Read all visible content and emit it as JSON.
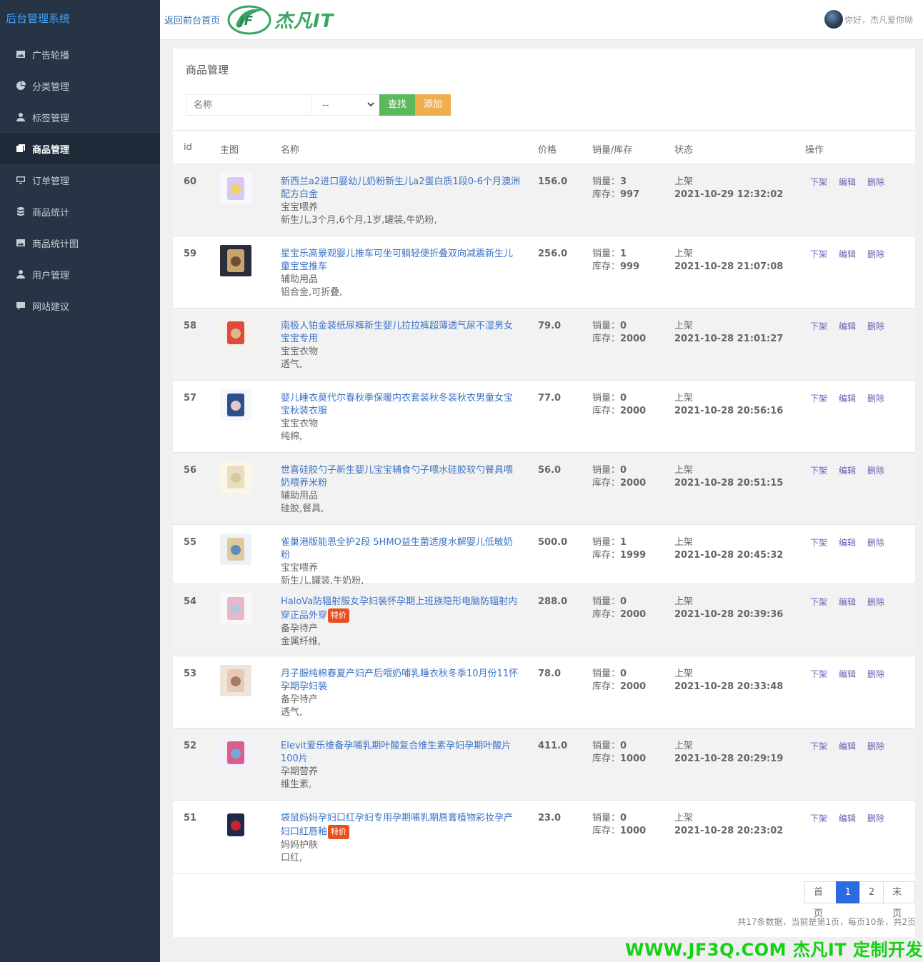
{
  "sidebar": {
    "brand": "后台管理系统",
    "items": [
      {
        "label": "广告轮播",
        "icon": "image-icon"
      },
      {
        "label": "分类管理",
        "icon": "pie-icon"
      },
      {
        "label": "标签管理",
        "icon": "user-tag-icon"
      },
      {
        "label": "商品管理",
        "icon": "window-icon",
        "active": true
      },
      {
        "label": "订单管理",
        "icon": "monitor-icon"
      },
      {
        "label": "商品统计",
        "icon": "database-icon"
      },
      {
        "label": "商品统计图",
        "icon": "image-icon"
      },
      {
        "label": "用户管理",
        "icon": "user-icon"
      },
      {
        "label": "网站建议",
        "icon": "comment-icon"
      }
    ]
  },
  "header": {
    "back_link": "返回前台首页",
    "logo_text": "杰凡IT",
    "greeting": "你好，杰凡爱你呦"
  },
  "page": {
    "title": "商品管理",
    "search": {
      "name_placeholder": "名称",
      "status_value": "--",
      "find_label": "查找",
      "add_label": "添加"
    }
  },
  "table": {
    "columns": [
      "id",
      "主图",
      "名称",
      "价格",
      "销量/库存",
      "状态",
      "操作"
    ],
    "sales_label": "销量：",
    "stock_label": "库存：",
    "actions": [
      "下架",
      "编辑",
      "删除"
    ],
    "rows": [
      {
        "id": "60",
        "name": "新西兰a2进口婴幼儿奶粉新生儿a2蛋白质1段0-6个月澳洲配方白金",
        "badge": "",
        "category": "宝宝喂养",
        "tags": "新生儿,3个月,6个月,1岁,罐装,牛奶粉,",
        "price": "156.0",
        "sales": "3",
        "stock": "997",
        "status": "上架",
        "time": "2021-10-29 12:32:02"
      },
      {
        "id": "59",
        "name": "星宝乐高景观婴儿推车可坐可躺轻便折叠双向减震新生儿童宝宝推车",
        "badge": "",
        "category": "辅助用品",
        "tags": "铝合金,可折叠,",
        "price": "256.0",
        "sales": "1",
        "stock": "999",
        "status": "上架",
        "time": "2021-10-28 21:07:08"
      },
      {
        "id": "58",
        "name": "南极人铂金装纸尿裤新生婴儿拉拉裤超薄透气尿不湿男女宝宝专用",
        "badge": "",
        "category": "宝宝衣物",
        "tags": "透气,",
        "price": "79.0",
        "sales": "0",
        "stock": "2000",
        "status": "上架",
        "time": "2021-10-28 21:01:27"
      },
      {
        "id": "57",
        "name": "婴儿睡衣莫代尔春秋季保暖内衣套装秋冬装秋衣男童女宝宝秋装衣服",
        "badge": "",
        "category": "宝宝衣物",
        "tags": "纯棉,",
        "price": "77.0",
        "sales": "0",
        "stock": "2000",
        "status": "上架",
        "time": "2021-10-28 20:56:16"
      },
      {
        "id": "56",
        "name": "世喜硅胶勺子新生婴儿宝宝辅食勺子喂水硅胶软勺餐具喂奶喂养米粉",
        "badge": "",
        "category": "辅助用品",
        "tags": "硅胶,餐具,",
        "price": "56.0",
        "sales": "0",
        "stock": "2000",
        "status": "上架",
        "time": "2021-10-28 20:51:15"
      },
      {
        "id": "55",
        "name": "雀巢港版能恩全护2段 5HMO益生菌适度水解婴儿低敏奶粉",
        "badge": "",
        "category": "宝宝喂养",
        "tags": "新生儿,罐装,牛奶粉,",
        "price": "500.0",
        "sales": "1",
        "stock": "1999",
        "status": "上架",
        "time": "2021-10-28 20:45:32"
      },
      {
        "id": "54",
        "name": "HaloVa防辐射服女孕妇装怀孕期上班族隐形电脑防辐射内穿正品外穿",
        "badge": "特价",
        "category": "备孕待产",
        "tags": "金属纤维,",
        "price": "288.0",
        "sales": "0",
        "stock": "2000",
        "status": "上架",
        "time": "2021-10-28 20:39:36"
      },
      {
        "id": "53",
        "name": "月子服纯棉春夏产妇产后喂奶哺乳睡衣秋冬季10月份11怀孕期孕妇装",
        "badge": "",
        "category": "备孕待产",
        "tags": "透气,",
        "price": "78.0",
        "sales": "0",
        "stock": "2000",
        "status": "上架",
        "time": "2021-10-28 20:33:48"
      },
      {
        "id": "52",
        "name": "Elevit爱乐维备孕哺乳期叶酸复合维生素孕妇孕期叶酸片100片",
        "badge": "",
        "category": "孕期营养",
        "tags": "维生素,",
        "price": "411.0",
        "sales": "0",
        "stock": "1000",
        "status": "上架",
        "time": "2021-10-28 20:29:19"
      },
      {
        "id": "51",
        "name": "袋鼠妈妈孕妇口红孕妇专用孕期哺乳期唇膏植物彩妆孕产妇口红唇釉",
        "badge": "特价",
        "category": "妈妈护肤",
        "tags": "口红,",
        "price": "23.0",
        "sales": "0",
        "stock": "1000",
        "status": "上架",
        "time": "2021-10-28 20:23:02"
      }
    ]
  },
  "pager": {
    "first": "首页",
    "pages": [
      "1",
      "2"
    ],
    "current": "1",
    "last": "末页",
    "info": "共17条数据，当前是第1页，每页10条，共2页"
  },
  "watermark": "WWW.JF3Q.COM 杰凡IT  定制开发",
  "colors": {
    "sidebar_bg": "#263445",
    "brand": "#3ea4ff",
    "link": "#3a72c6",
    "find_button": "#5cb85c",
    "add_button": "#f0ad4e",
    "badge": "#e8501f",
    "pager_active": "#2d6be4",
    "watermark": "#14d114"
  }
}
